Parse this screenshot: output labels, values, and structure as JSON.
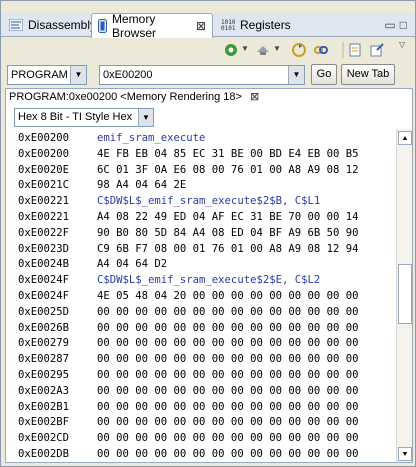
{
  "tabs": [
    {
      "label": "Disassembly",
      "icon": "disassembly-icon"
    },
    {
      "label": "Memory Browser",
      "icon": "memory-icon",
      "active": true,
      "close": "⊠"
    },
    {
      "label": "Registers",
      "icon": "registers-icon"
    }
  ],
  "controls": {
    "page_value": "PROGRAM",
    "address_value": "0xE00200",
    "go_label": "Go",
    "newtab_label": "New Tab"
  },
  "rendering": {
    "title": "PROGRAM:0xe00200 <Memory Rendering 18>",
    "close": "⊠",
    "format_value": "Hex 8 Bit - TI Style Hex"
  },
  "memory": {
    "rows": [
      {
        "addr": "0xE00200",
        "bytes": "emif_sram_execute",
        "is_label": true
      },
      {
        "addr": "0xE00200",
        "bytes": "4E FB EB 04 85 EC 31 BE 00 BD E4 EB 00 B5",
        "is_label": false
      },
      {
        "addr": "0xE0020E",
        "bytes": "6C 01 3F 0A E6 08 00 76 01 00 A8 A9 08 12",
        "is_label": false
      },
      {
        "addr": "0xE0021C",
        "bytes": "98 A4 04 64 2E",
        "is_label": false
      },
      {
        "addr": "0xE00221",
        "bytes": "C$DW$L$_emif_sram_execute$2$B, C$L1",
        "is_label": true
      },
      {
        "addr": "0xE00221",
        "bytes": "A4 08 22 49 ED 04 AF EC 31 BE 70 00 00 14",
        "is_label": false
      },
      {
        "addr": "0xE0022F",
        "bytes": "90 B0 80 5D 84 A4 08 ED 04 BF A9 6B 50 90",
        "is_label": false
      },
      {
        "addr": "0xE0023D",
        "bytes": "C9 6B F7 08 00 01 76 01 00 A8 A9 08 12 94",
        "is_label": false
      },
      {
        "addr": "0xE0024B",
        "bytes": "A4 04 64 D2",
        "is_label": false
      },
      {
        "addr": "0xE0024F",
        "bytes": "C$DW$L$_emif_sram_execute$2$E, C$L2",
        "is_label": true
      },
      {
        "addr": "0xE0024F",
        "bytes": "4E 05 48 04 20 00 00 00 00 00 00 00 00 00",
        "is_label": false
      },
      {
        "addr": "0xE0025D",
        "bytes": "00 00 00 00 00 00 00 00 00 00 00 00 00 00",
        "is_label": false
      },
      {
        "addr": "0xE0026B",
        "bytes": "00 00 00 00 00 00 00 00 00 00 00 00 00 00",
        "is_label": false
      },
      {
        "addr": "0xE00279",
        "bytes": "00 00 00 00 00 00 00 00 00 00 00 00 00 00",
        "is_label": false
      },
      {
        "addr": "0xE00287",
        "bytes": "00 00 00 00 00 00 00 00 00 00 00 00 00 00",
        "is_label": false
      },
      {
        "addr": "0xE00295",
        "bytes": "00 00 00 00 00 00 00 00 00 00 00 00 00 00",
        "is_label": false
      },
      {
        "addr": "0xE002A3",
        "bytes": "00 00 00 00 00 00 00 00 00 00 00 00 00 00",
        "is_label": false
      },
      {
        "addr": "0xE002B1",
        "bytes": "00 00 00 00 00 00 00 00 00 00 00 00 00 00",
        "is_label": false
      },
      {
        "addr": "0xE002BF",
        "bytes": "00 00 00 00 00 00 00 00 00 00 00 00 00 00",
        "is_label": false
      },
      {
        "addr": "0xE002CD",
        "bytes": "00 00 00 00 00 00 00 00 00 00 00 00 00 00",
        "is_label": false
      },
      {
        "addr": "0xE002DB",
        "bytes": "00 00 00 00 00 00 00 00 00 00 00 00 00 00",
        "is_label": false
      }
    ]
  },
  "colors": {
    "label_text": "#2a3aa8",
    "tab_bar": "#dfe6ef",
    "chrome": "#ece9d8"
  }
}
